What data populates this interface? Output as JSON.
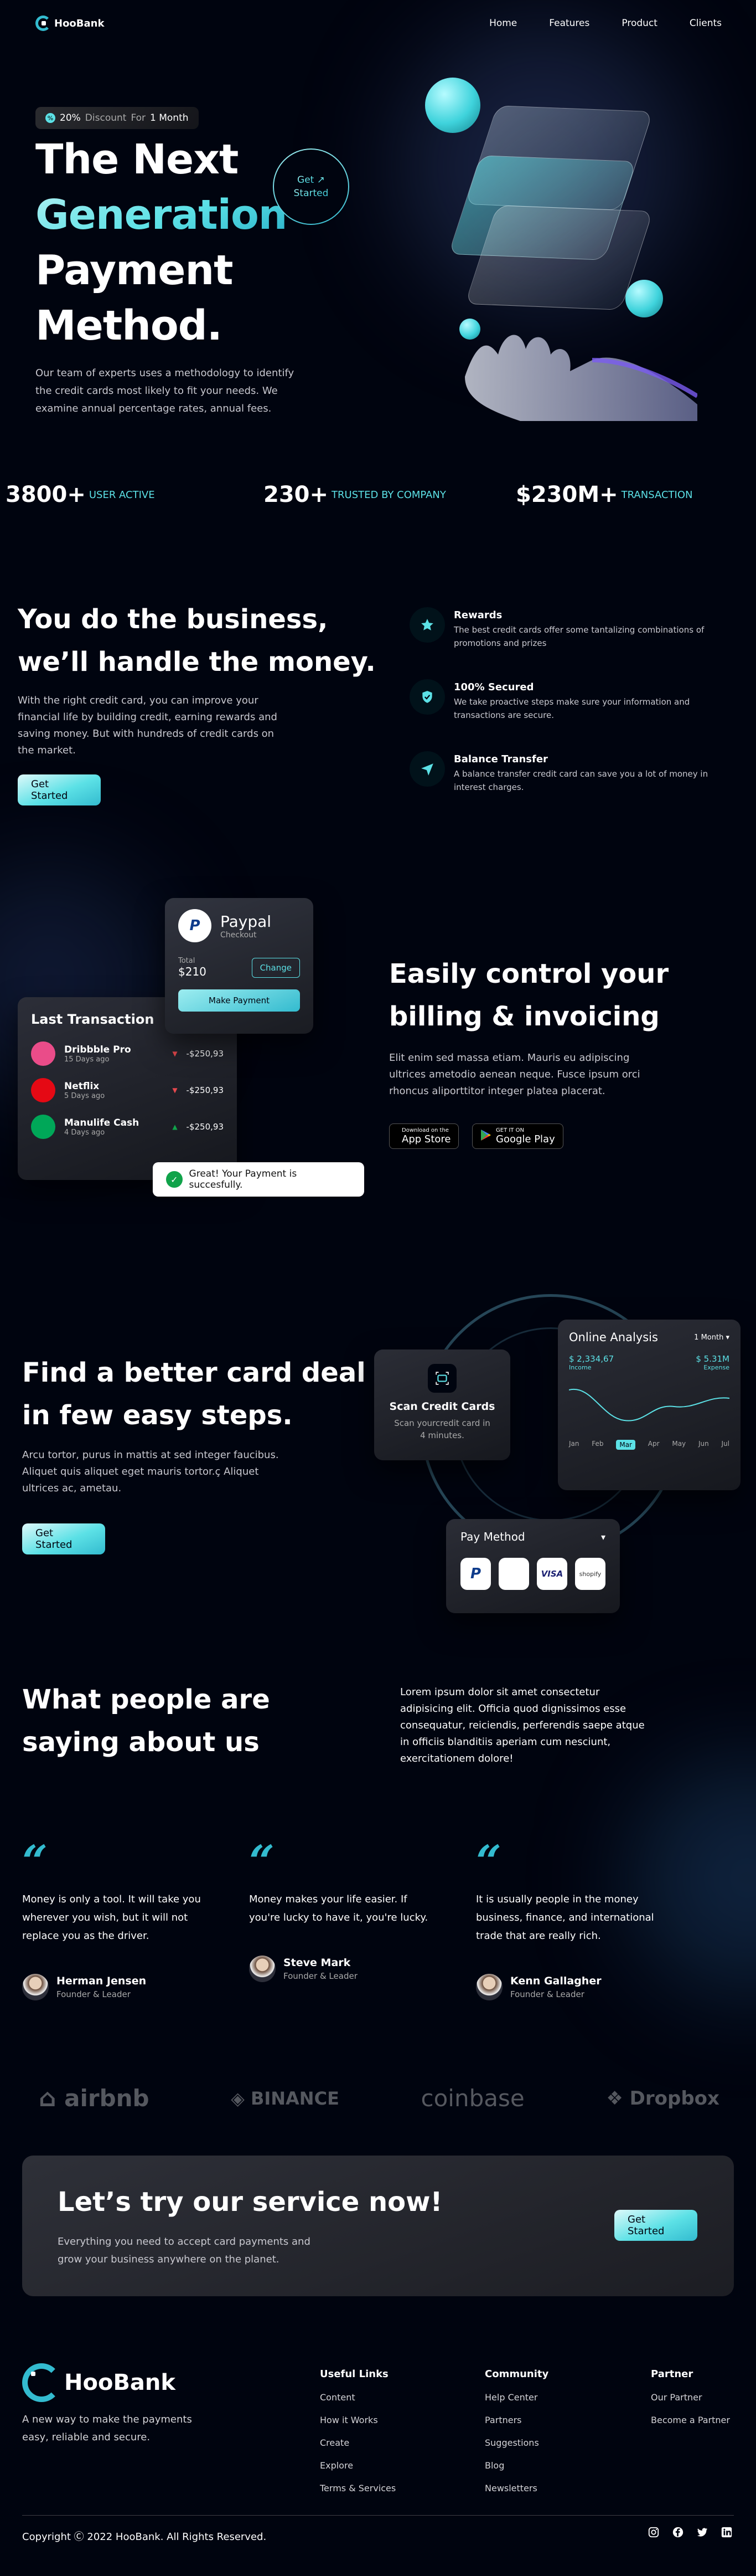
{
  "nav": {
    "brand": "HooBank",
    "links": [
      "Home",
      "Features",
      "Product",
      "Clients"
    ]
  },
  "hero": {
    "badge_pct": "20%",
    "badge_mid": "Discount",
    "badge_for": "For",
    "badge_end": "1 Month",
    "title_1": "The Next",
    "title_2": "Generation",
    "title_3": "Payment",
    "title_4": "Method.",
    "get_1": "Get",
    "get_2": "Started",
    "subtitle": "Our team of experts uses a methodology to identify the credit cards most likely to fit your needs. We examine annual percentage rates, annual fees."
  },
  "stats": [
    {
      "value": "3800+",
      "label": "User Active"
    },
    {
      "value": "230+",
      "label": "Trusted by Company"
    },
    {
      "value": "$230M+",
      "label": "Transaction"
    }
  ],
  "business": {
    "title_1": "You do the business,",
    "title_2": "we’ll handle the money.",
    "text": "With the right credit card, you can improve your financial life by building credit, earning rewards and saving money. But with hundreds of credit cards on the market.",
    "button": "Get Started",
    "features": [
      {
        "title": "Rewards",
        "text": "The best credit cards offer some tantalizing combinations of promotions and prizes",
        "icon": "star-icon"
      },
      {
        "title": "100% Secured",
        "text": "We take proactive steps make sure your information and transactions are secure.",
        "icon": "shield-icon"
      },
      {
        "title": "Balance Transfer",
        "text": "A balance transfer credit card can save you a lot of money in interest charges.",
        "icon": "send-icon"
      }
    ]
  },
  "billing": {
    "title_1": "Easily control your",
    "title_2": "billing & invoicing",
    "text": "Elit enim sed massa etiam. Mauris eu adipiscing ultrices ametodio aenean neque. Fusce ipsum orci rhoncus aliporttitor integer platea placerat.",
    "appstore_small": "Download on the",
    "appstore_big": "App Store",
    "play_small": "GET IT ON",
    "play_big": "Google Play",
    "paypal": {
      "name": "Paypal",
      "sub": "Checkout",
      "total_label": "Total",
      "total": "$210",
      "change": "Change",
      "pay": "Make Payment"
    },
    "transactions": {
      "title": "Last Transaction",
      "items": [
        {
          "name": "Dribbble Pro",
          "date": "15 Days ago",
          "amount": "-$250,93",
          "color": "#ea4c89",
          "down": true
        },
        {
          "name": "Netflix",
          "date": "5 Days ago",
          "amount": "-$250,93",
          "color": "#e50914",
          "down": true
        },
        {
          "name": "Manulife Cash",
          "date": "4 Days ago",
          "amount": "-$250,93",
          "color": "#00a758",
          "down": false
        }
      ]
    },
    "toast": "Great! Your Payment is succesfully."
  },
  "deal": {
    "title_1": "Find a better card deal",
    "title_2": "in few easy steps.",
    "text": "Arcu tortor, purus in mattis at sed integer faucibus. Aliquet quis aliquet eget mauris tortor.ç Aliquet ultrices ac, ametau.",
    "button": "Get Started",
    "scan_title": "Scan Credit Cards",
    "scan_text": "Scan yourcredit card in 4 minutes.",
    "analysis": {
      "title": "Online Analysis",
      "period": "1 Month",
      "income": "$ 2,334,67",
      "income_label": "Income",
      "expense": "$ 5.31M",
      "expense_label": "Expense",
      "months": [
        "Jan",
        "Feb",
        "Mar",
        "Apr",
        "May",
        "Jun",
        "Jul"
      ],
      "active": "Mar"
    },
    "pay_method": "Pay Method",
    "methods": [
      "paypal",
      "apple",
      "VISA",
      "shopify"
    ]
  },
  "testimonials": {
    "title_1": "What people are",
    "title_2": "saying about us",
    "text": "Lorem ipsum dolor sit amet consectetur adipisicing elit. Officia quod dignissimos esse consequatur, reiciendis, perferendis saepe atque in officiis blanditiis aperiam cum nesciunt, exercitationem dolore!",
    "items": [
      {
        "text": "Money is only a tool. It will take you wherever you wish, but it will not replace you as the driver.",
        "name": "Herman Jensen",
        "role": "Founder & Leader"
      },
      {
        "text": "Money makes your life easier. If you're lucky to have it, you're lucky.",
        "name": "Steve Mark",
        "role": "Founder & Leader"
      },
      {
        "text": "It is usually people in the money business, finance, and international trade that are really rich.",
        "name": "Kenn Gallagher",
        "role": "Founder & Leader"
      }
    ]
  },
  "partners": [
    "airbnb",
    "BINANCE",
    "coinbase",
    "Dropbox"
  ],
  "cta": {
    "title": "Let’s try our service now!",
    "text": "Everything you need to accept card payments and grow your business anywhere on the planet.",
    "button": "Get Started"
  },
  "footer": {
    "brand": "HooBank",
    "tagline": "A new way to make the payments easy, reliable and secure.",
    "cols": [
      {
        "title": "Useful Links",
        "links": [
          "Content",
          "How it Works",
          "Create",
          "Explore",
          "Terms & Services"
        ]
      },
      {
        "title": "Community",
        "links": [
          "Help Center",
          "Partners",
          "Suggestions",
          "Blog",
          "Newsletters"
        ]
      },
      {
        "title": "Partner",
        "links": [
          "Our Partner",
          "Become a Partner"
        ]
      }
    ],
    "copyright": "Copyright Ⓒ 2022 HooBank. All Rights Reserved.",
    "social": [
      "instagram-icon",
      "facebook-icon",
      "twitter-icon",
      "linkedin-icon"
    ]
  },
  "colors": {
    "accent": "#5ce1e6",
    "accent_dark": "#33bbcf",
    "bg": "#00040f"
  }
}
